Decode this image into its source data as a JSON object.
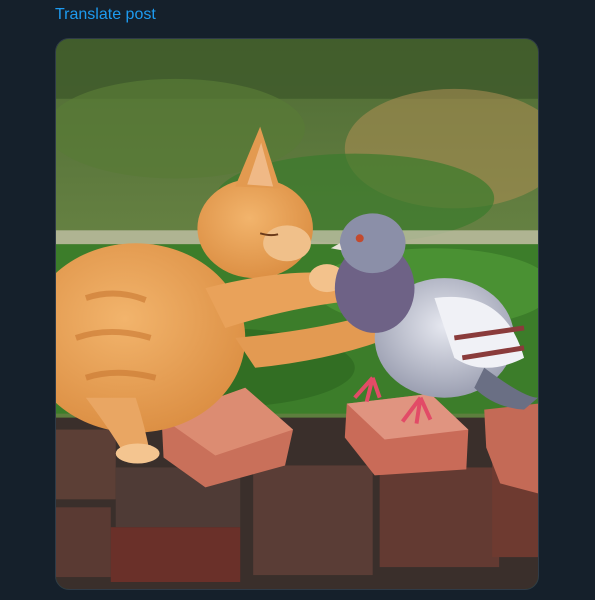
{
  "post": {
    "translate_label": "Translate post",
    "media": {
      "type": "photo"
    }
  },
  "colors": {
    "background": "#15202b",
    "link": "#1d9bf0"
  }
}
